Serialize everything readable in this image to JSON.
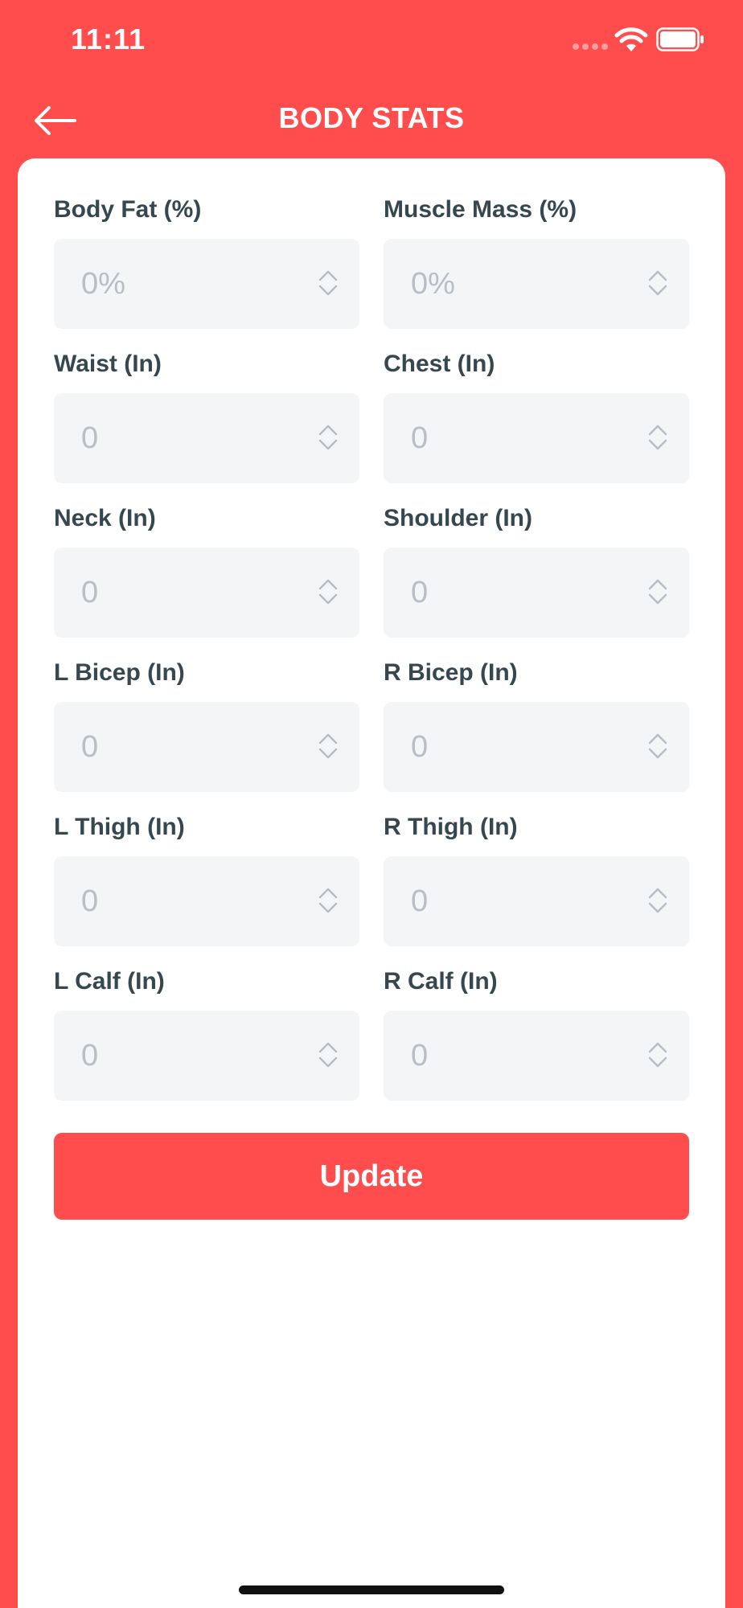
{
  "status": {
    "time": "11:11"
  },
  "header": {
    "title": "BODY STATS"
  },
  "colors": {
    "accent": "#ff4c4c",
    "label": "#37474f",
    "input_bg": "#f4f5f7",
    "placeholder": "#b7bec6"
  },
  "icons": {
    "back": "arrow-left-icon",
    "stepper": "up-down-chevron-icon",
    "wifi": "wifi-icon",
    "battery": "battery-icon"
  },
  "fields": [
    {
      "label": "Body Fat (%)",
      "placeholder": "0%"
    },
    {
      "label": "Muscle Mass (%)",
      "placeholder": "0%"
    },
    {
      "label": "Waist (In)",
      "placeholder": "0"
    },
    {
      "label": "Chest (In)",
      "placeholder": "0"
    },
    {
      "label": "Neck (In)",
      "placeholder": "0"
    },
    {
      "label": "Shoulder (In)",
      "placeholder": "0"
    },
    {
      "label": "L Bicep (In)",
      "placeholder": "0"
    },
    {
      "label": "R Bicep (In)",
      "placeholder": "0"
    },
    {
      "label": "L Thigh (In)",
      "placeholder": "0"
    },
    {
      "label": "R Thigh (In)",
      "placeholder": "0"
    },
    {
      "label": "L Calf (In)",
      "placeholder": "0"
    },
    {
      "label": "R Calf (In)",
      "placeholder": "0"
    }
  ],
  "actions": {
    "update_label": "Update"
  }
}
